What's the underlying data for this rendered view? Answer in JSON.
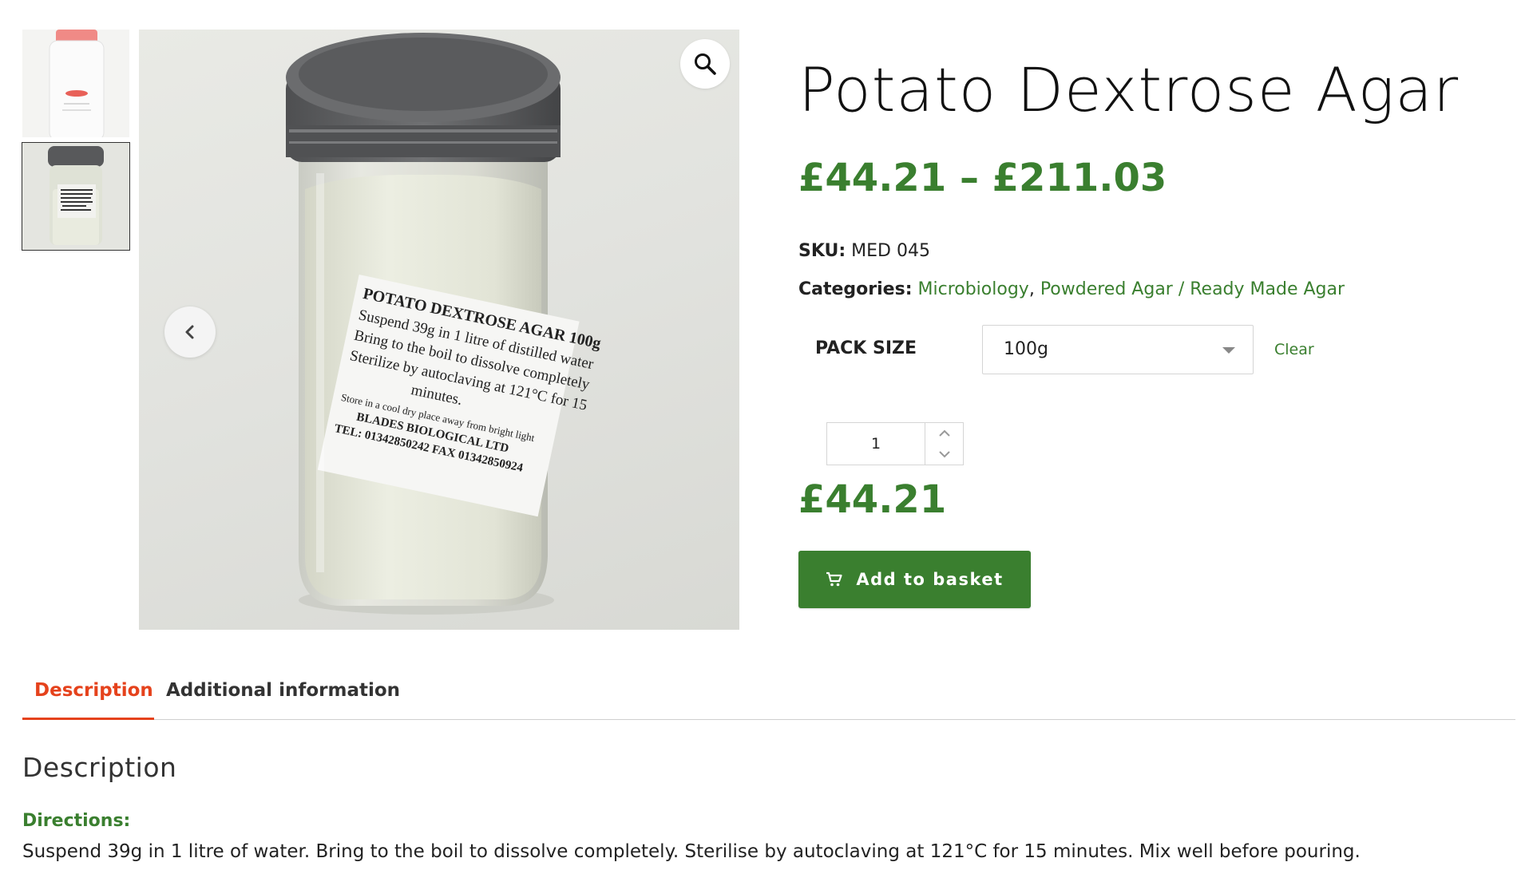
{
  "product": {
    "title": "Potato Dextrose Agar",
    "price_range": "£44.21 – £211.03",
    "sku_label": "SKU:",
    "sku_value": "MED 045",
    "categories_label": "Categories:",
    "categories": [
      "Microbiology",
      "Powdered Agar / Ready Made Agar"
    ],
    "categories_separator": ", ",
    "pack_size_label": "PACK SIZE",
    "pack_size_selected": "100g",
    "clear_label": "Clear",
    "quantity": "1",
    "price": "£44.21",
    "add_to_basket_label": "Add to basket"
  },
  "gallery": {
    "label_lines": [
      "POTATO DEXTROSE AGAR   100g",
      "Suspend 39g in 1 litre of distilled water",
      "Bring to the boil to dissolve completely",
      "Sterilize by autoclaving at 121°C for 15",
      "minutes.",
      "Store in a cool dry place away from bright light",
      "BLADES BIOLOGICAL LTD",
      "TEL: 01342850242  FAX 01342850924"
    ]
  },
  "tabs": {
    "description": "Description",
    "additional": "Additional information"
  },
  "description": {
    "heading": "Description",
    "directions_label": "Directions:",
    "directions_text": "Suspend 39g in 1 litre of water. Bring to the boil to dissolve completely. Sterilise by autoclaving at 121°C for 15 minutes. Mix well before pouring."
  },
  "colors": {
    "accent_green": "#3a7f2f",
    "active_tab": "#e5421c"
  },
  "icons": {
    "zoom": "magnifier-icon",
    "prev": "chevron-left-icon",
    "cart": "cart-icon",
    "select": "caret-down-icon",
    "qty_up": "chevron-up-icon",
    "qty_down": "chevron-down-icon"
  }
}
